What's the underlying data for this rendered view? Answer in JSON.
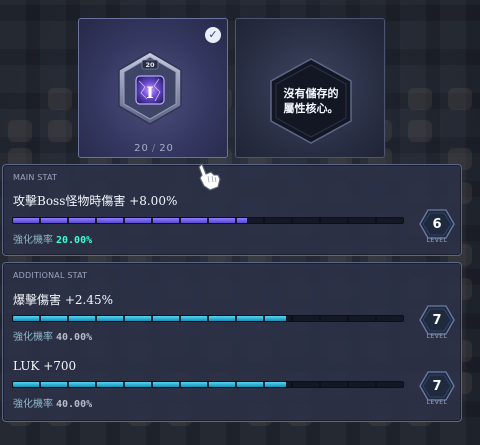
{
  "core_slots": {
    "equipped": {
      "level_badge": "20",
      "core_glyph": "I",
      "count_current": "20",
      "count_separator": "/",
      "count_max": "20",
      "selected": true
    },
    "empty": {
      "message_line1": "沒有儲存的",
      "message_line2": "屬性核心。"
    }
  },
  "main_stat": {
    "section_title": "MAIN STAT",
    "name": "攻擊Boss怪物時傷害 +8.00%",
    "progress": 0.6,
    "rate_label": "強化機率",
    "rate_value": "20.00%",
    "level": "6",
    "level_word": "LEVEL"
  },
  "additional_stat": {
    "section_title": "ADDITIONAL STAT",
    "items": [
      {
        "name": "爆擊傷害 +2.45%",
        "progress": 0.7,
        "rate_label": "強化機率",
        "rate_value": "40.00%",
        "level": "7",
        "level_word": "LEVEL"
      },
      {
        "name": "LUK +700",
        "progress": 0.7,
        "rate_label": "強化機率",
        "rate_value": "40.00%",
        "level": "7",
        "level_word": "LEVEL"
      }
    ]
  },
  "colors": {
    "main_bar": "#7a66f0",
    "additional_bar": "#35c2e3",
    "main_rate": "#38ffd5",
    "additional_rate": "#b4bcc9",
    "level_hex": "#1f2a3f"
  }
}
